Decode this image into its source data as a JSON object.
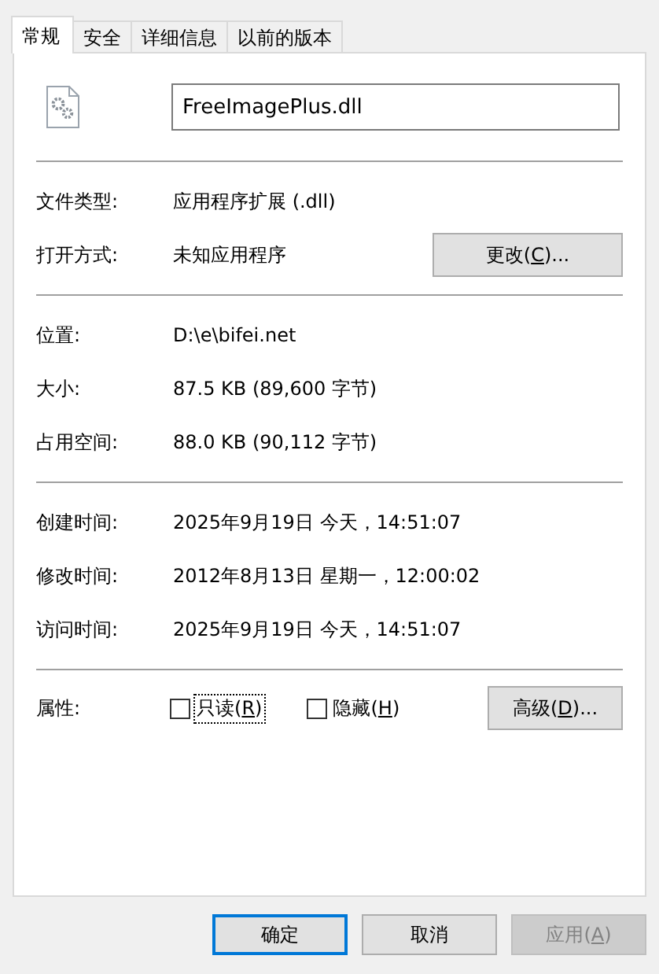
{
  "tabs": [
    {
      "label": "常规",
      "selected": true
    },
    {
      "label": "安全",
      "selected": false
    },
    {
      "label": "详细信息",
      "selected": false
    },
    {
      "label": "以前的版本",
      "selected": false
    }
  ],
  "file_name": {
    "value": "FreeImagePlus.dll"
  },
  "sections": [
    {
      "rows": [
        {
          "label": "文件类型:",
          "value": "应用程序扩展 (.dll)"
        },
        {
          "label": "打开方式:",
          "value": "未知应用程序",
          "button": {
            "before": "更改(",
            "key": "C",
            "after": ")..."
          }
        }
      ]
    },
    {
      "rows": [
        {
          "label": "位置:",
          "value": "D:\\e\\bifei.net"
        },
        {
          "label": "大小:",
          "value": "87.5 KB (89,600 字节)"
        },
        {
          "label": "占用空间:",
          "value": "88.0 KB (90,112 字节)"
        }
      ]
    },
    {
      "rows": [
        {
          "label": "创建时间:",
          "value": "2025年9月19日 今天，14:51:07"
        },
        {
          "label": "修改时间:",
          "value": "2012年8月13日 星期一，12:00:02"
        },
        {
          "label": "访问时间:",
          "value": "2025年9月19日 今天，14:51:07"
        }
      ]
    }
  ],
  "attributes": {
    "label": "属性:",
    "checkboxes": [
      {
        "before": "只读(",
        "key": "R",
        "after": ")",
        "checked": false,
        "focused": true
      },
      {
        "before": "隐藏(",
        "key": "H",
        "after": ")",
        "checked": false,
        "focused": false
      }
    ],
    "button": {
      "before": "高级(",
      "key": "D",
      "after": ")..."
    }
  },
  "buttons": [
    {
      "before": "确定",
      "default": true,
      "disabled": false
    },
    {
      "before": "取消",
      "default": false,
      "disabled": false
    },
    {
      "before": "应用(",
      "key": "A",
      "after": ")",
      "default": false,
      "disabled": true
    }
  ]
}
